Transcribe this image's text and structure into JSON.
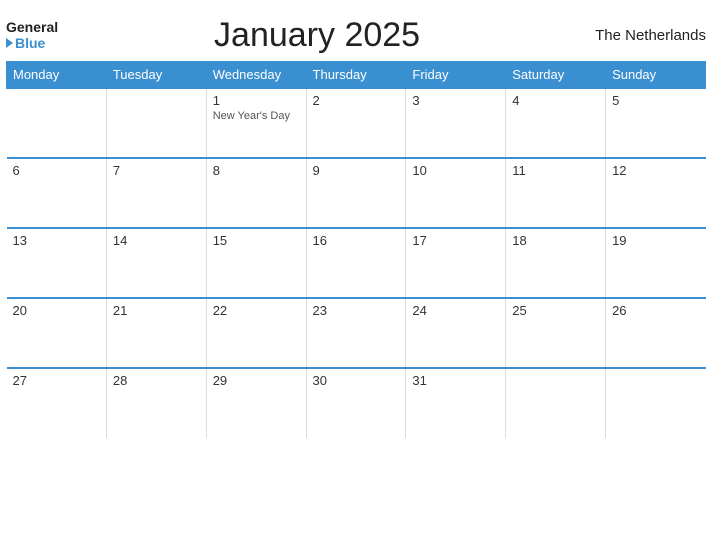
{
  "header": {
    "title": "January 2025",
    "country": "The Netherlands",
    "logo_general": "General",
    "logo_blue": "Blue"
  },
  "weekdays": [
    "Monday",
    "Tuesday",
    "Wednesday",
    "Thursday",
    "Friday",
    "Saturday",
    "Sunday"
  ],
  "weeks": [
    [
      {
        "day": "",
        "empty": true
      },
      {
        "day": "",
        "empty": true
      },
      {
        "day": "1",
        "event": "New Year's Day"
      },
      {
        "day": "2"
      },
      {
        "day": "3"
      },
      {
        "day": "4"
      },
      {
        "day": "5"
      }
    ],
    [
      {
        "day": "6"
      },
      {
        "day": "7"
      },
      {
        "day": "8"
      },
      {
        "day": "9"
      },
      {
        "day": "10"
      },
      {
        "day": "11"
      },
      {
        "day": "12"
      }
    ],
    [
      {
        "day": "13"
      },
      {
        "day": "14"
      },
      {
        "day": "15"
      },
      {
        "day": "16"
      },
      {
        "day": "17"
      },
      {
        "day": "18"
      },
      {
        "day": "19"
      }
    ],
    [
      {
        "day": "20"
      },
      {
        "day": "21"
      },
      {
        "day": "22"
      },
      {
        "day": "23"
      },
      {
        "day": "24"
      },
      {
        "day": "25"
      },
      {
        "day": "26"
      }
    ],
    [
      {
        "day": "27"
      },
      {
        "day": "28"
      },
      {
        "day": "29"
      },
      {
        "day": "30"
      },
      {
        "day": "31"
      },
      {
        "day": "",
        "empty": true
      },
      {
        "day": "",
        "empty": true
      }
    ]
  ]
}
